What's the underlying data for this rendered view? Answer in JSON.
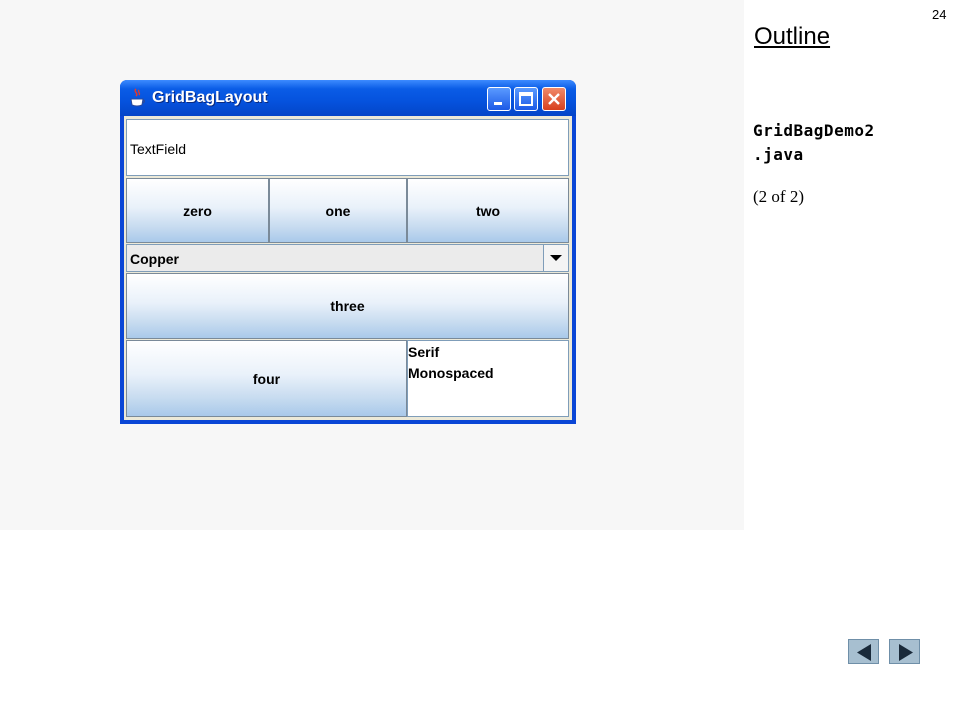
{
  "slide": {
    "number": "24",
    "outline_title": "Outline",
    "file_name_lines": [
      "GridBagDemo2",
      ".java"
    ],
    "page_indicator": "(2 of 2)"
  },
  "window": {
    "title": "GridBagLayout",
    "textfield_value": "TextField",
    "buttons": {
      "zero": "zero",
      "one": "one",
      "two": "two",
      "three": "three",
      "four": "four"
    },
    "combo_selected": "Copper",
    "list_items": [
      "Serif",
      "Monospaced"
    ]
  },
  "icons": {
    "app": "java-coffee-icon",
    "minimize": "minimize-icon",
    "maximize": "maximize-icon",
    "close": "close-icon",
    "combo_arrow": "chevron-down-icon",
    "prev": "previous-slide-icon",
    "next": "next-slide-icon"
  },
  "colors": {
    "titlebar": "#0a5ce6",
    "window_border": "#0a46d6",
    "close_button": "#d8401e",
    "nav_button": "#a7bfd0"
  }
}
